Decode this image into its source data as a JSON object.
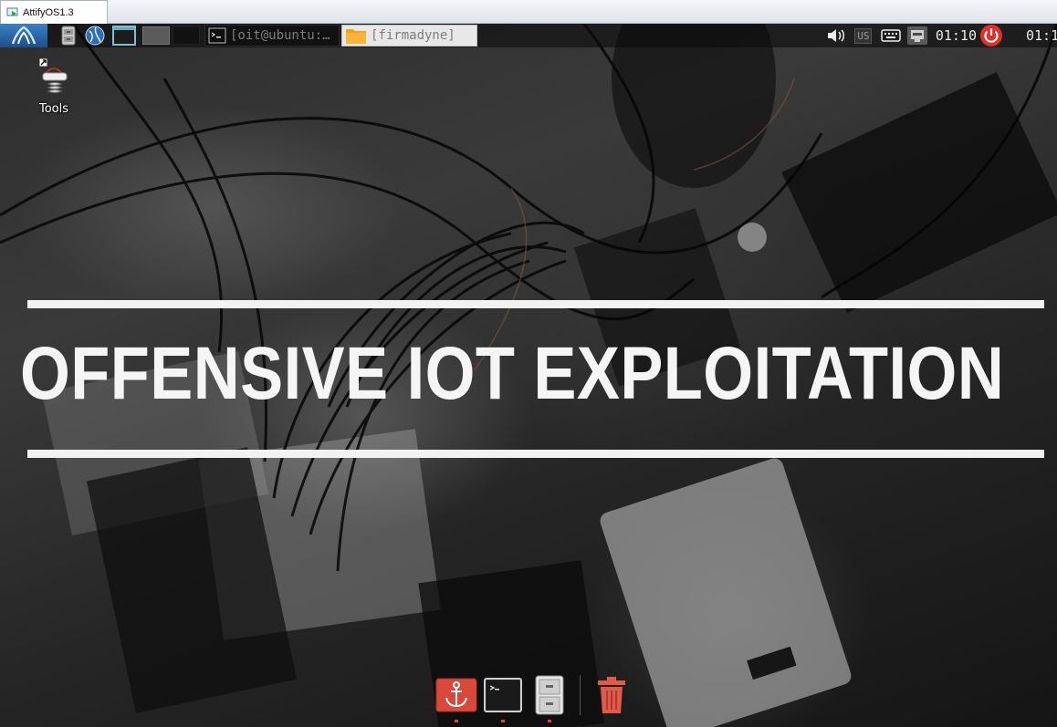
{
  "vm_window": {
    "tab_title": "AttifyOS1.3"
  },
  "panel": {
    "task_buttons": [
      {
        "label": "[oit@ubuntu:…",
        "icon": "terminal-icon"
      },
      {
        "label": "[firmadyne]",
        "icon": "folder-icon"
      }
    ],
    "tray": {
      "keyboard_layout": "US",
      "clock": "01:10",
      "clock_secondary": "01:1"
    }
  },
  "desktop": {
    "icons": [
      {
        "label": "Tools",
        "icon": "tools-router-icon"
      }
    ],
    "banner": {
      "title": "OFFENSIVE IOT EXPLOITATION"
    }
  },
  "dock": {
    "items": [
      "anchor-app-icon",
      "terminal-icon",
      "file-cabinet-icon",
      "trash-icon"
    ]
  },
  "colors": {
    "panel_bg": "#0a0a0a",
    "menu_blue": "#2a62a3",
    "banner_white": "#f2f2f2",
    "power_red": "#e0302a",
    "dock_red": "#d9483b"
  }
}
